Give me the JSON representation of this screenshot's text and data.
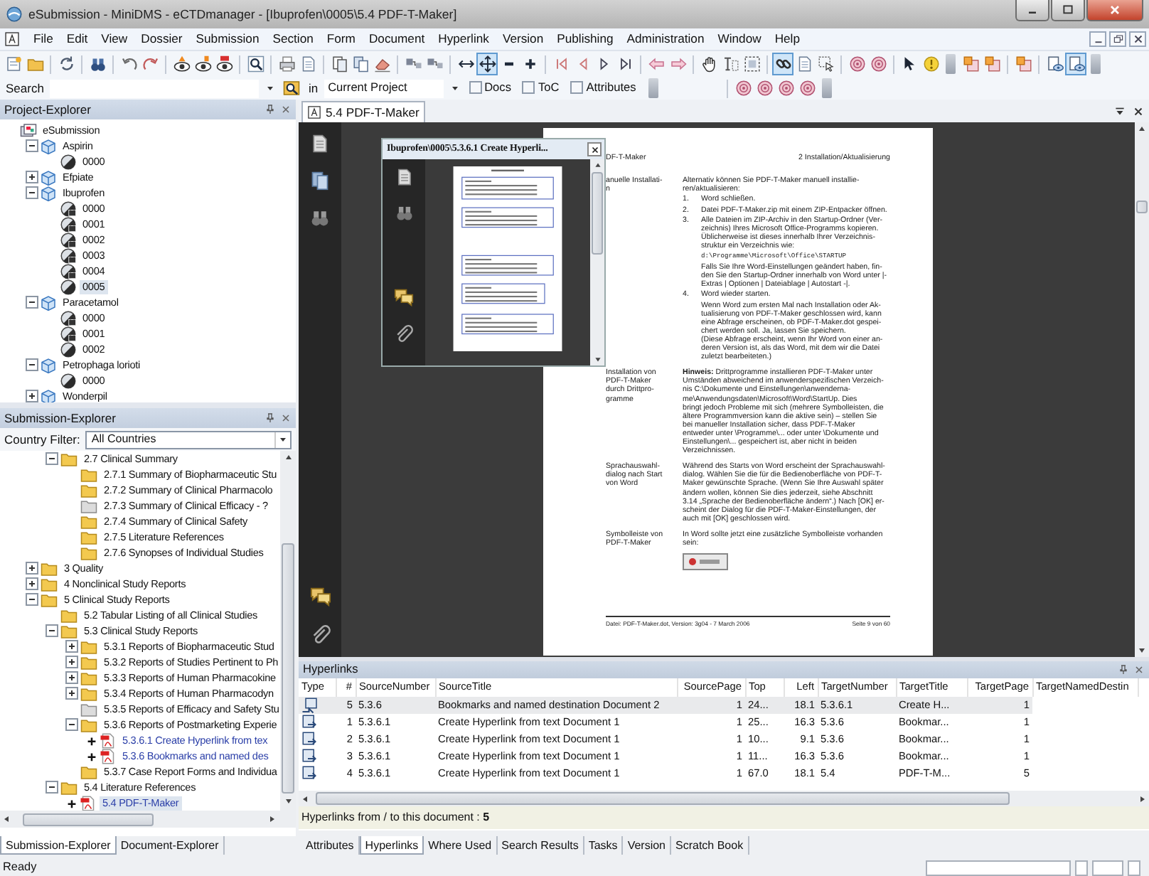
{
  "window": {
    "title": "eSubmission - MiniDMS - eCTDmanager - [Ibuprofen\\0005\\5.4 PDF-T-Maker]"
  },
  "menu": [
    {
      "label": "File"
    },
    {
      "label": "Edit"
    },
    {
      "label": "View"
    },
    {
      "label": "Dossier"
    },
    {
      "label": "Submission"
    },
    {
      "label": "Section"
    },
    {
      "label": "Form"
    },
    {
      "label": "Document"
    },
    {
      "label": "Hyperlink"
    },
    {
      "label": "Version"
    },
    {
      "label": "Publishing"
    },
    {
      "label": "Administration"
    },
    {
      "label": "Window"
    },
    {
      "label": "Help"
    }
  ],
  "toolbars": [
    [
      [
        {
          "kind": "new-document",
          "pressed": false
        },
        {
          "kind": "open-folder",
          "pressed": false
        }
      ],
      [
        {
          "kind": "refresh",
          "pressed": false
        }
      ],
      [
        {
          "kind": "binoculars",
          "pressed": false
        }
      ],
      [
        {
          "kind": "undo",
          "pressed": false
        },
        {
          "kind": "redo",
          "pressed": false
        }
      ],
      [
        {
          "kind": "eye-warning",
          "pressed": false
        },
        {
          "kind": "eye-number",
          "pressed": false
        },
        {
          "kind": "eye-alert",
          "pressed": false
        }
      ],
      [
        {
          "kind": "search",
          "pressed": false
        }
      ],
      [
        {
          "kind": "print",
          "pressed": false
        },
        {
          "kind": "page",
          "pressed": false
        }
      ],
      [
        {
          "kind": "page-stack",
          "pressed": false
        },
        {
          "kind": "copy",
          "pressed": false
        },
        {
          "kind": "eraser",
          "pressed": false
        }
      ],
      [
        {
          "kind": "link-nodes",
          "pressed": false
        },
        {
          "kind": "link-nodes",
          "pressed": false
        }
      ],
      [
        {
          "kind": "h-arrow",
          "pressed": false
        },
        {
          "kind": "move",
          "pressed": true
        },
        {
          "kind": "minus",
          "pressed": false
        },
        {
          "kind": "plus",
          "pressed": false
        }
      ],
      [
        {
          "kind": "first",
          "pressed": false
        },
        {
          "kind": "prev",
          "pressed": false
        },
        {
          "kind": "next",
          "pressed": false
        },
        {
          "kind": "last",
          "pressed": false
        }
      ],
      [
        {
          "kind": "back",
          "pressed": false
        },
        {
          "kind": "forward",
          "pressed": false
        }
      ],
      [
        {
          "kind": "hand",
          "pressed": false
        },
        {
          "kind": "text-select",
          "pressed": false
        },
        {
          "kind": "region-select",
          "pressed": false
        }
      ],
      [
        {
          "kind": "link",
          "pressed": true
        },
        {
          "kind": "page",
          "pressed": false
        },
        {
          "kind": "cursor-select",
          "pressed": false
        }
      ],
      [
        {
          "kind": "target",
          "pressed": false
        },
        {
          "kind": "target",
          "pressed": false
        }
      ],
      [
        {
          "kind": "pointer",
          "pressed": false
        },
        {
          "kind": "help",
          "pressed": false
        }
      ]
    ],
    [
      [
        {
          "kind": "doc-link",
          "pressed": false
        },
        {
          "kind": "doc-link",
          "pressed": false
        }
      ],
      [
        {
          "kind": "doc-link",
          "pressed": false
        }
      ],
      [
        {
          "kind": "doc-preview",
          "pressed": false
        },
        {
          "kind": "doc-preview",
          "pressed": true
        }
      ]
    ]
  ],
  "search_bar": {
    "label": "Search",
    "scope_label": "in",
    "scope": "Current Project",
    "options": [
      {
        "label": "Docs",
        "checked": false
      },
      {
        "label": "ToC",
        "checked": false
      },
      {
        "label": "Attributes",
        "checked": false
      }
    ],
    "toolbar": [
      {
        "kind": "target",
        "pressed": false
      },
      {
        "kind": "target",
        "pressed": false
      },
      {
        "kind": "target",
        "pressed": false
      },
      {
        "kind": "target",
        "pressed": false
      }
    ]
  },
  "project_explorer": {
    "title": "Project-Explorer",
    "tree": [
      {
        "label": "eSubmission",
        "kind": "root",
        "selected": false,
        "children": [
          {
            "label": "Aspirin",
            "kind": "product",
            "expanded": true,
            "selected": false,
            "children": [
              {
                "label": "0000",
                "kind": "sequence",
                "locked": false,
                "selected": false
              }
            ]
          },
          {
            "label": "Efpiate",
            "kind": "product",
            "expanded": false,
            "selected": false
          },
          {
            "label": "Ibuprofen",
            "kind": "product",
            "expanded": true,
            "selected": false,
            "children": [
              {
                "label": "0000",
                "kind": "sequence",
                "locked": true,
                "selected": false
              },
              {
                "label": "0001",
                "kind": "sequence",
                "locked": true,
                "selected": false
              },
              {
                "label": "0002",
                "kind": "sequence",
                "locked": true,
                "selected": false
              },
              {
                "label": "0003",
                "kind": "sequence",
                "locked": true,
                "selected": false
              },
              {
                "label": "0004",
                "kind": "sequence",
                "locked": true,
                "selected": false
              },
              {
                "label": "0005",
                "kind": "sequence",
                "locked": false,
                "selected": true
              }
            ]
          },
          {
            "label": "Paracetamol",
            "kind": "product",
            "expanded": true,
            "selected": false,
            "children": [
              {
                "label": "0000",
                "kind": "sequence",
                "locked": true,
                "selected": false
              },
              {
                "label": "0001",
                "kind": "sequence",
                "locked": true,
                "selected": false
              },
              {
                "label": "0002",
                "kind": "sequence",
                "locked": false,
                "selected": false
              }
            ]
          },
          {
            "label": "Petrophaga lorioti",
            "kind": "product",
            "expanded": true,
            "selected": false,
            "children": [
              {
                "label": "0000",
                "kind": "sequence",
                "locked": false,
                "selected": false
              }
            ]
          },
          {
            "label": "Wonderpil",
            "kind": "product",
            "expanded": false,
            "selected": false
          }
        ]
      }
    ]
  },
  "submission_explorer": {
    "title": "Submission-Explorer",
    "filter_label": "Country Filter:",
    "filter_value": "All Countries",
    "continued": [
      {
        "label": "2.7 Clinical Summary",
        "kind": "folder",
        "expanded": true,
        "selected": false,
        "children": [
          {
            "label": "2.7.1 Summary of Biopharmaceutic Stu",
            "kind": "folder",
            "selected": false
          },
          {
            "label": "2.7.2 Summary of Clinical Pharmacolo",
            "kind": "folder",
            "selected": false
          },
          {
            "label": "2.7.3 Summary of Clinical Efficacy - ?",
            "kind": "empty-folder",
            "selected": false
          },
          {
            "label": "2.7.4 Summary of Clinical Safety",
            "kind": "folder",
            "selected": false
          },
          {
            "label": "2.7.5 Literature References",
            "kind": "folder",
            "selected": false
          },
          {
            "label": "2.7.6 Synopses of Individual Studies",
            "kind": "folder",
            "selected": false
          }
        ]
      }
    ],
    "tree": [
      {
        "label": "3 Quality",
        "kind": "folder",
        "expanded": false,
        "selected": false
      },
      {
        "label": "4 Nonclinical Study Reports",
        "kind": "folder",
        "expanded": false,
        "selected": false
      },
      {
        "label": "5 Clinical Study Reports",
        "kind": "folder",
        "expanded": true,
        "selected": false,
        "children": [
          {
            "label": "5.2 Tabular Listing of all Clinical Studies",
            "kind": "folder",
            "selected": false
          },
          {
            "label": "5.3 Clinical Study Reports",
            "kind": "folder",
            "expanded": true,
            "selected": false,
            "children": [
              {
                "label": "5.3.1 Reports of Biopharmaceutic Stud",
                "kind": "folder",
                "expanded": false,
                "selected": false
              },
              {
                "label": "5.3.2 Reports of Studies Pertinent to Ph",
                "kind": "folder",
                "expanded": false,
                "selected": false
              },
              {
                "label": "5.3.3 Reports of Human Pharmacokine",
                "kind": "folder",
                "expanded": false,
                "selected": false
              },
              {
                "label": "5.3.4 Reports of Human Pharmacodyn",
                "kind": "folder",
                "expanded": false,
                "selected": false
              },
              {
                "label": "5.3.5 Reports of Efficacy and Safety Stu",
                "kind": "empty-folder",
                "selected": false
              },
              {
                "label": "5.3.6 Reports of Postmarketing Experie",
                "kind": "folder",
                "expanded": true,
                "selected": false,
                "children": [
                  {
                    "label": "5.3.6.1 Create Hyperlink from tex",
                    "kind": "document",
                    "expanded": false,
                    "selected": false
                  },
                  {
                    "label": "5.3.6 Bookmarks and named des",
                    "kind": "document",
                    "expanded": false,
                    "selected": false
                  }
                ]
              },
              {
                "label": "5.3.7 Case Report Forms and Individua",
                "kind": "folder",
                "selected": false
              }
            ]
          },
          {
            "label": "5.4 Literature References",
            "kind": "folder",
            "expanded": true,
            "selected": false,
            "children": [
              {
                "label": "5.4 PDF-T-Maker",
                "kind": "document",
                "expanded": false,
                "selected": true
              }
            ]
          }
        ]
      }
    ]
  },
  "left_tabs": [
    {
      "label": "Submission-Explorer",
      "selected": true
    },
    {
      "label": "Document-Explorer",
      "selected": false
    }
  ],
  "document": {
    "tab": "5.4 PDF-T-Maker",
    "popup": {
      "title": "Ibuprofen\\0005\\5.3.6.1 Create Hyperli..."
    },
    "page": {
      "header_left": "DF-T-Maker",
      "header_right": "2 Installation/Aktualisierung",
      "sections": [
        {
          "label": "anuelle Installati-\nn",
          "blocks": [
            {
              "kind": "para",
              "text": "Alternativ können Sie PDF-T-Maker manuell installie-\nren/aktualisieren:"
            },
            {
              "kind": "step",
              "number": "1.",
              "text": "Word schließen."
            },
            {
              "kind": "step",
              "number": "2.",
              "text": "Datei PDF-T-Maker.zip mit einem ZIP-Entpacker öffnen."
            },
            {
              "kind": "step",
              "number": "3.",
              "text": "Alle Dateien im ZIP-Archiv in den Startup-Ordner (Ver-\nzeichnis) Ihres Microsoft Office-Programms kopieren.\nÜblicherweise ist dieses innerhalb Ihrer Verzeichnis-\nstruktur ein Verzeichnis wie:"
            },
            {
              "kind": "code",
              "text": "d:\\Programme\\Microsoft\\Office\\STARTUP"
            },
            {
              "kind": "note",
              "text": "Falls Sie Ihre Word-Einstellungen geändert haben, fin-\nden Sie den Startup-Ordner innerhalb von Word unter |-\nExtras | Optionen | Dateiablage | Autostart -|."
            },
            {
              "kind": "step",
              "number": "4.",
              "text": "Word wieder starten."
            },
            {
              "kind": "note",
              "text": "Wenn Word zum ersten Mal nach Installation oder Ak-\ntualisierung von PDF-T-Maker geschlossen wird, kann\neine Abfrage erscheinen, ob PDF-T-Maker.dot gespei-\nchert werden soll. Ja, lassen Sie speichern.\n(Diese Abfrage erscheint, wenn Ihr Word von einer an-\nderen Version ist, als das Word, mit dem wir die Datei\nzuletzt bearbeiteten.)"
            }
          ]
        },
        {
          "label": "Installation von\nPDF-T-Maker\ndurch Drittpro-\ngramme",
          "blocks": [
            {
              "kind": "para",
              "text": "**Hinweis:** Drittprogramme installieren PDF-T-Maker unter\nUmständen abweichend im anwenderspezifischen Verzeich-\nnis C:\\Dokumente und Einstellungen\\anwenderna-\nme\\Anwendungsdaten\\Microsoft\\Word\\StartUp. Dies\nbringt jedoch Probleme mit sich (mehrere Symbolleisten, die\nältere Programmversion kann die aktive sein) – stellen Sie\nbei manueller Installation sicher, dass PDF-T-Maker\nentweder unter \\Programme\\... oder unter \\Dokumente und\nEinstellungen\\... gespeichert ist, aber nicht in beiden\nVerzeichnissen."
            }
          ]
        },
        {
          "label": "Sprachauswahl-\ndialog nach Start\nvon Word",
          "blocks": [
            {
              "kind": "para",
              "text": "Während des Starts von Word erscheint der Sprachauswahl-\ndialog. Wählen Sie die für die Bedienoberfläche von PDF-T-\nMaker gewünschte Sprache. (Wenn Sie Ihre Auswahl später\nändern wollen, können Sie dies jederzeit, siehe Abschnitt\n3.14 „Sprache der Bedienoberfläche ändern“.) Nach [OK] er-\nscheint der Dialog für die PDF-T-Maker-Einstellungen, der\nauch mit [OK] geschlossen wird."
            }
          ]
        },
        {
          "label": "Symbolleiste von\nPDF-T-Maker",
          "blocks": [
            {
              "kind": "para",
              "text": "In Word sollte jetzt eine zusätzliche Symbolleiste vorhanden\nsein:"
            },
            {
              "kind": "image"
            }
          ]
        }
      ],
      "footer_left": "Datei: PDF-T-Maker.dot, Version: 3g04 - 7 March 2006",
      "footer_right": "Seite 9 von 60"
    }
  },
  "hyperlinks": {
    "title": "Hyperlinks",
    "type_column": "Type",
    "columns": [
      "#",
      "SourceNumber",
      "SourceTitle",
      "SourcePage",
      "Top",
      "Left",
      "TargetNumber",
      "TargetTitle",
      "TargetPage",
      "TargetNamedDestin"
    ],
    "rows": [
      {
        "kind": "incoming",
        "selected": true,
        "cells": [
          "5",
          "5.3.6",
          "Bookmarks and named destination Document 2",
          "1",
          "24...",
          "18.1",
          "5.3.6.1",
          "Create H...",
          "1"
        ]
      },
      {
        "kind": "outgoing",
        "selected": false,
        "cells": [
          "1",
          "5.3.6.1",
          "Create Hyperlink from text Document 1",
          "1",
          "25...",
          "16.3",
          "5.3.6",
          "Bookmar...",
          "1"
        ]
      },
      {
        "kind": "outgoing",
        "selected": false,
        "cells": [
          "2",
          "5.3.6.1",
          "Create Hyperlink from text Document 1",
          "1",
          "10...",
          "9.1",
          "5.3.6",
          "Bookmar...",
          "1"
        ]
      },
      {
        "kind": "outgoing",
        "selected": false,
        "cells": [
          "3",
          "5.3.6.1",
          "Create Hyperlink from text Document 1",
          "1",
          "11...",
          "16.3",
          "5.3.6",
          "Bookmar...",
          "1"
        ]
      },
      {
        "kind": "outgoing",
        "selected": false,
        "cells": [
          "4",
          "5.3.6.1",
          "Create Hyperlink from text Document 1",
          "1",
          "67.0",
          "18.1",
          "5.4",
          "PDF-T-M...",
          "5"
        ]
      }
    ],
    "summary": "Hyperlinks from / to this document : **5**"
  },
  "bottom_tabs": [
    {
      "label": "Attributes",
      "selected": false
    },
    {
      "label": "Hyperlinks",
      "selected": true
    },
    {
      "label": "Where Used",
      "selected": false
    },
    {
      "label": "Search Results",
      "selected": false
    },
    {
      "label": "Tasks",
      "selected": false
    },
    {
      "label": "Version",
      "selected": false
    },
    {
      "label": "Scratch Book",
      "selected": false
    }
  ],
  "status_bar": {
    "text": "Ready"
  }
}
